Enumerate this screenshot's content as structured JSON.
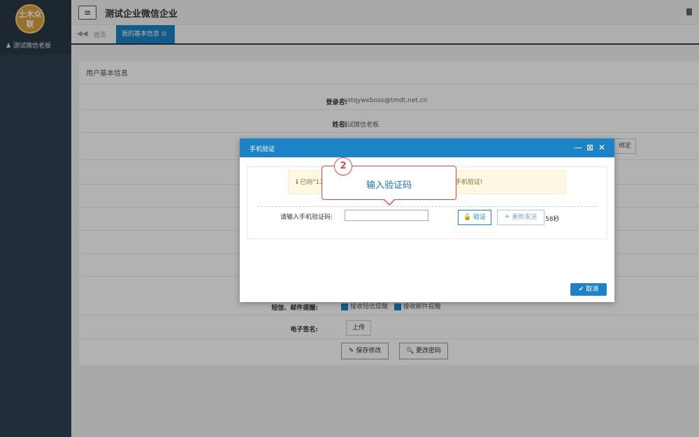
{
  "sidebar": {
    "logo_text": "土木众联",
    "user_name": "测试微信老板"
  },
  "header": {
    "menu_icon": "≡",
    "enterprise_title": "测试企业微信企业"
  },
  "tabs": {
    "home_label": "首页",
    "active_label": "我的基本信息 ⊙"
  },
  "panel": {
    "title": "用户基本信息",
    "rows": [
      {
        "label": "登录名:",
        "value": "testqywxboss@tmdt.net.cn"
      },
      {
        "label": "姓名:",
        "value": "测试微信老板"
      }
    ],
    "bind_label": "绑定",
    "sms_label": "短信、邮件提醒:",
    "sms_option": "接收短信提醒",
    "email_option": "接收邮件提醒",
    "signature_label": "电子签名:",
    "upload_label": "上传",
    "save_label": "✎ 保存修改",
    "change_pwd_label": "🔍 更改密码"
  },
  "modal": {
    "title": "手机验证",
    "minimize_label": "—",
    "maximize_label": "⊠",
    "close_label": "✕",
    "alert_left": "ℹ 已向\"13",
    "alert_right": "手机验证!",
    "code_label": "请输入手机验证码:",
    "code_value": "",
    "verify_label": "🔓 验证",
    "resend_label": "✈ 重新发送",
    "countdown": "58秒",
    "cancel_label": "✔ 取消"
  },
  "callout": {
    "step_number": "2",
    "text": "输入验证码"
  },
  "colors": {
    "accent": "#1c84c6",
    "sidebar": "#2f4050",
    "callout_border": "#e0464a"
  }
}
